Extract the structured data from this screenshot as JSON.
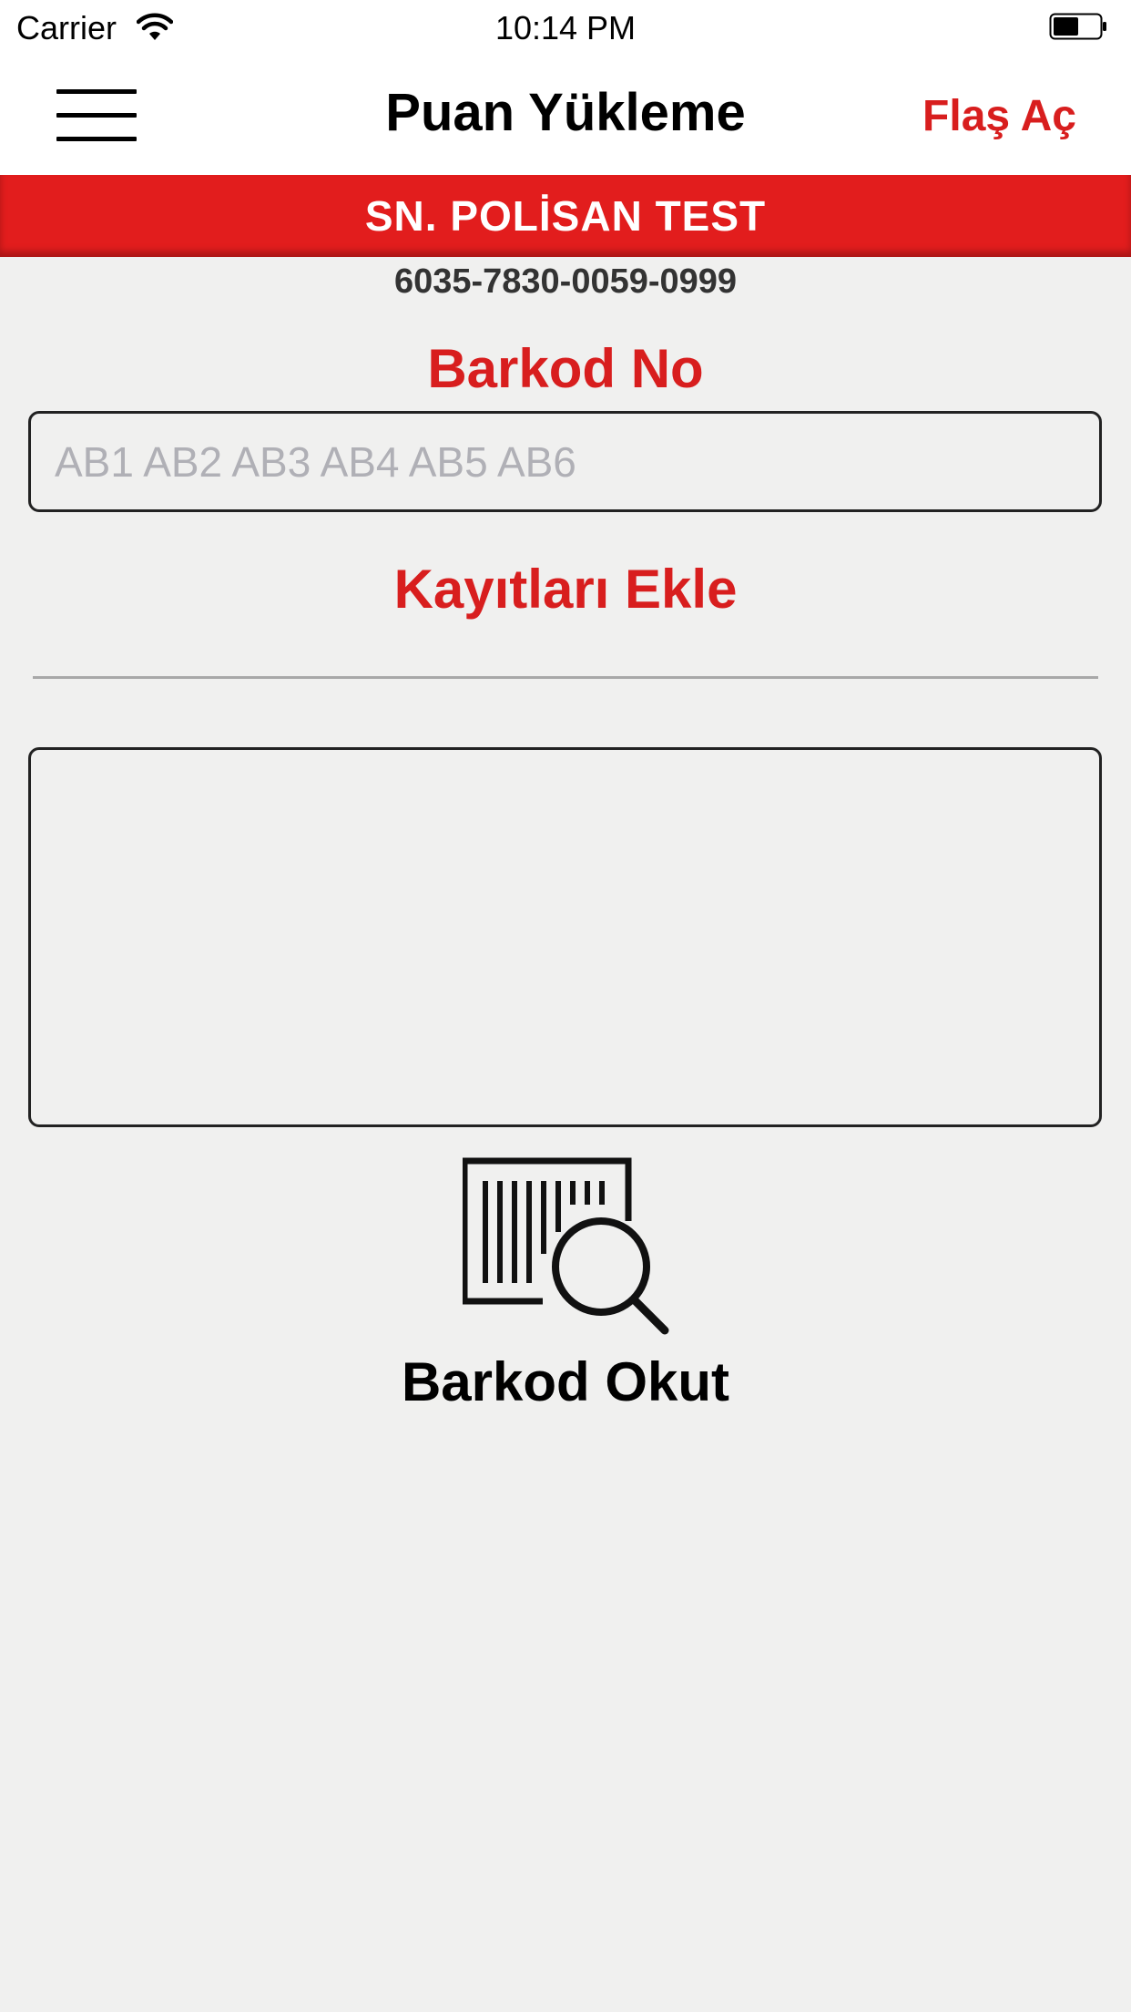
{
  "status_bar": {
    "carrier": "Carrier",
    "time": "10:14 PM"
  },
  "nav": {
    "title": "Puan Yükleme",
    "flash_label": "Flaş Aç"
  },
  "customer": {
    "name": "SN. POLİSAN TEST",
    "card_number": "6035-7830-0059-0999"
  },
  "barcode": {
    "label": "Barkod No",
    "placeholder": "AB1 AB2 AB3 AB4 AB5 AB6",
    "value": ""
  },
  "actions": {
    "add_records_label": "Kayıtları Ekle",
    "scan_label": "Barkod Okut"
  },
  "colors": {
    "accent": "#e21d1d",
    "background": "#f0f0ef",
    "header": "#ffffff"
  }
}
